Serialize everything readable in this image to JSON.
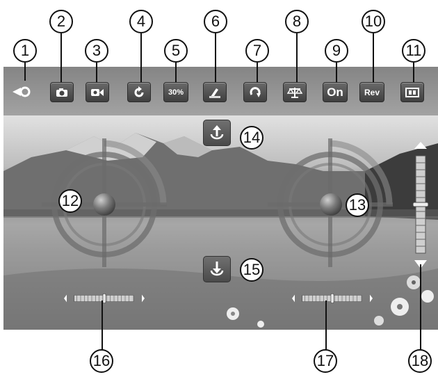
{
  "callouts": [
    "1",
    "2",
    "3",
    "4",
    "5",
    "6",
    "7",
    "8",
    "9",
    "10",
    "11",
    "12",
    "13",
    "14",
    "15",
    "16",
    "17",
    "18"
  ],
  "toolbar": {
    "speed_label": "30%",
    "on_label": "On",
    "rev_label": "Rev"
  },
  "icons": {
    "b1": "back-arrow-icon",
    "b2": "camera-icon",
    "b3": "video-icon",
    "b4": "rotate-icon",
    "b6": "calibrate-icon",
    "b7": "flip-icon",
    "b8": "balance-icon",
    "b11": "screen-icon",
    "up": "takeoff-icon",
    "down": "land-icon"
  }
}
